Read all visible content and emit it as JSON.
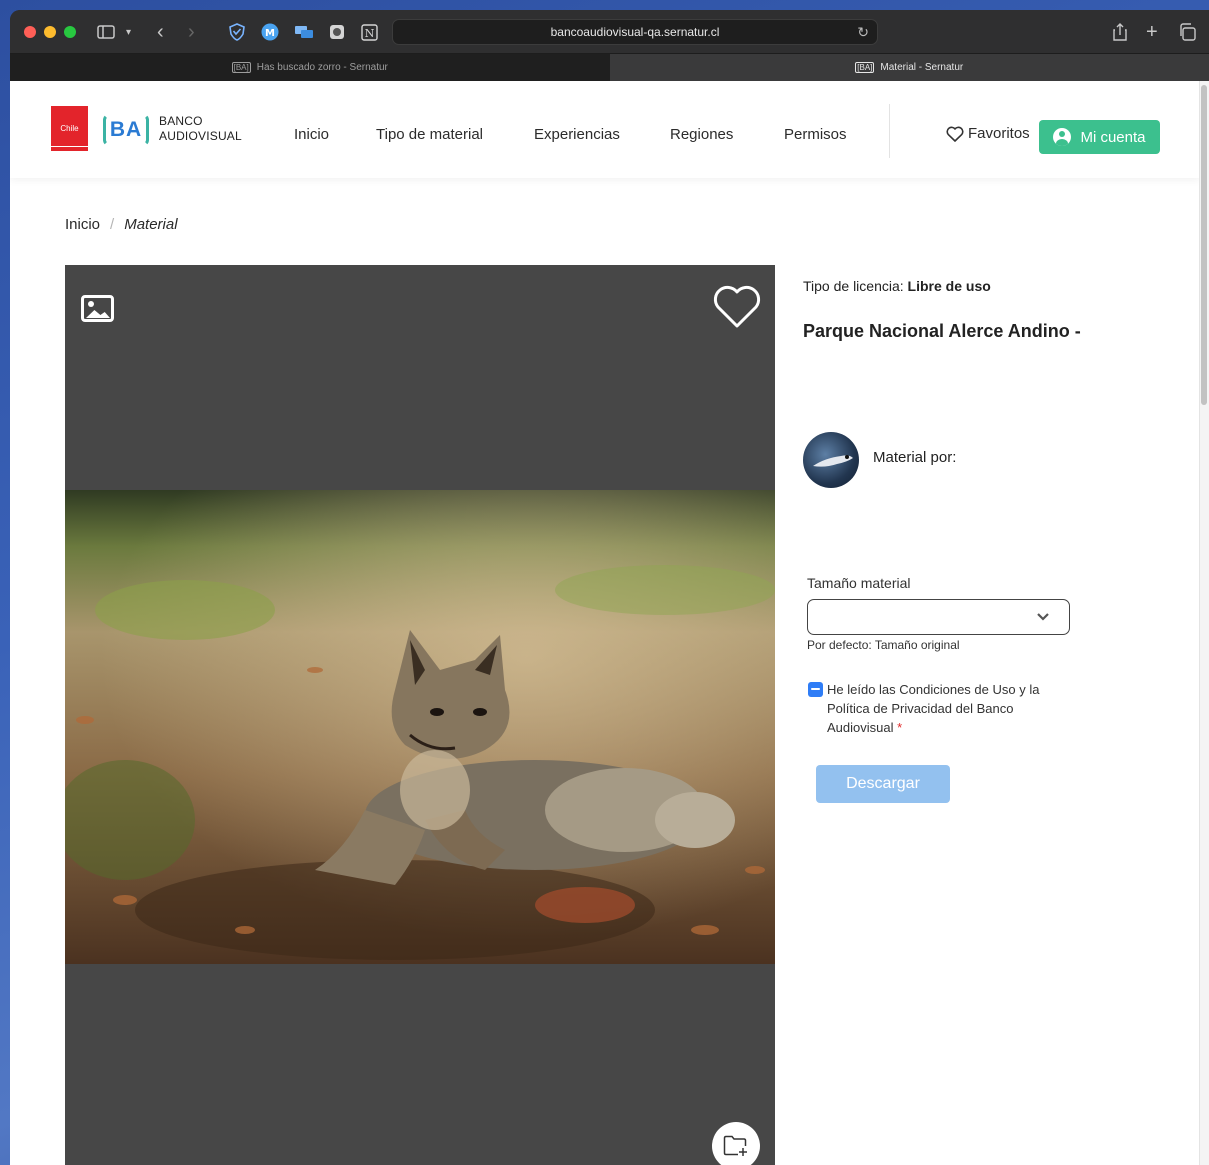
{
  "browser": {
    "url": "bancoaudiovisual-qa.sernatur.cl",
    "tabs": [
      {
        "favicon": "[BA]",
        "title": "Has buscado zorro - Sernatur",
        "active": false
      },
      {
        "favicon": "[BA]",
        "title": "Material - Sernatur",
        "active": true
      }
    ]
  },
  "header": {
    "chile_logo": "Chile",
    "ba_logo": "BA",
    "brand_line1": "BANCO",
    "brand_line2": "AUDIOVISUAL",
    "nav": [
      "Inicio",
      "Tipo de material",
      "Experiencias",
      "Regiones",
      "Permisos"
    ],
    "favorites": "Favoritos",
    "account": "Mi cuenta",
    "accent_color": "#3cc08e"
  },
  "breadcrumb": {
    "home": "Inicio",
    "separator": "/",
    "current": "Material"
  },
  "viewer": {
    "media_type_icon": "image-icon",
    "favorite_icon": "heart-outline-icon",
    "add_to_folder_icon": "folder-plus-icon"
  },
  "details": {
    "license_label": "Tipo de licencia:",
    "license_value": "Libre de uso",
    "title": "Parque Nacional Alerce Andino -",
    "author_label": "Material por:",
    "size_label": "Tamaño material",
    "size_value": "",
    "size_hint": "Por defecto: Tamaño original",
    "terms_text": "He leído las Condiciones de Uso y la Política de Privacidad del Banco Audiovisual",
    "required_mark": "*",
    "download_button": "Descargar",
    "download_color": "#93c1ef"
  }
}
